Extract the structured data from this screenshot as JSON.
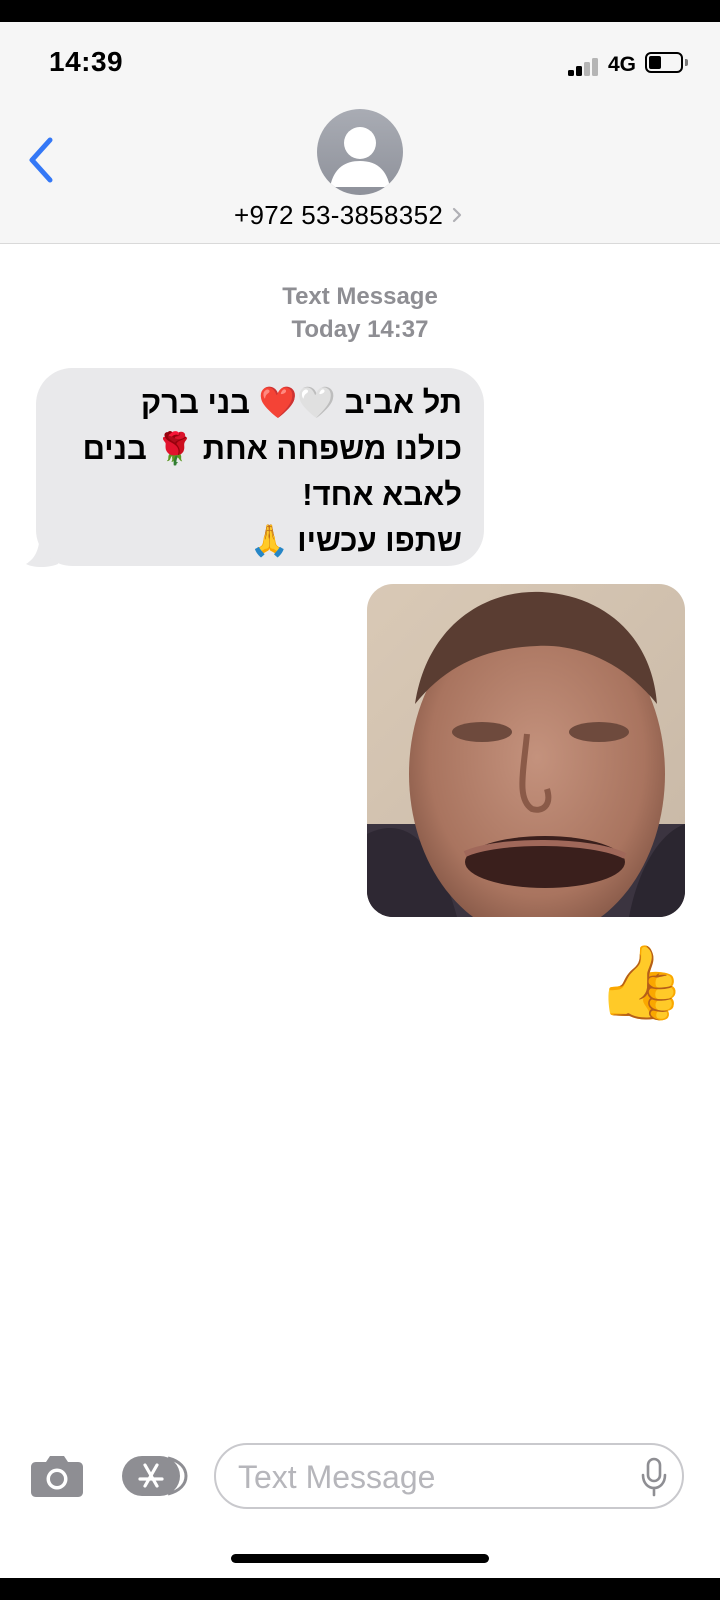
{
  "status_bar": {
    "time": "14:39",
    "network": "4G"
  },
  "header": {
    "contact": "+972 53-3858352",
    "back_icon": "chevron-left-icon",
    "avatar_icon": "person-silhouette-icon"
  },
  "conversation": {
    "service_label": "Text Message",
    "timestamp": "Today 14:37",
    "messages": [
      {
        "direction": "incoming",
        "type": "text",
        "lines": [
          "תל אביב 🤍❤️ בני ברק",
          "כולנו משפחה אחת 🌹 בנים",
          "לאבא אחד!",
          "שתפו עכשיו 🙏"
        ]
      },
      {
        "direction": "outgoing",
        "type": "image",
        "content": "photo"
      },
      {
        "direction": "outgoing",
        "type": "emoji",
        "content": "👍"
      }
    ]
  },
  "input_bar": {
    "placeholder": "Text Message",
    "camera_icon": "camera-icon",
    "apps_icon": "app-store-icon",
    "mic_icon": "microphone-icon"
  },
  "colors": {
    "accent": "#3478f6",
    "incoming_bubble": "#e9e9eb",
    "header_bg": "#f6f6f6",
    "meta_text": "#8e8e93"
  }
}
